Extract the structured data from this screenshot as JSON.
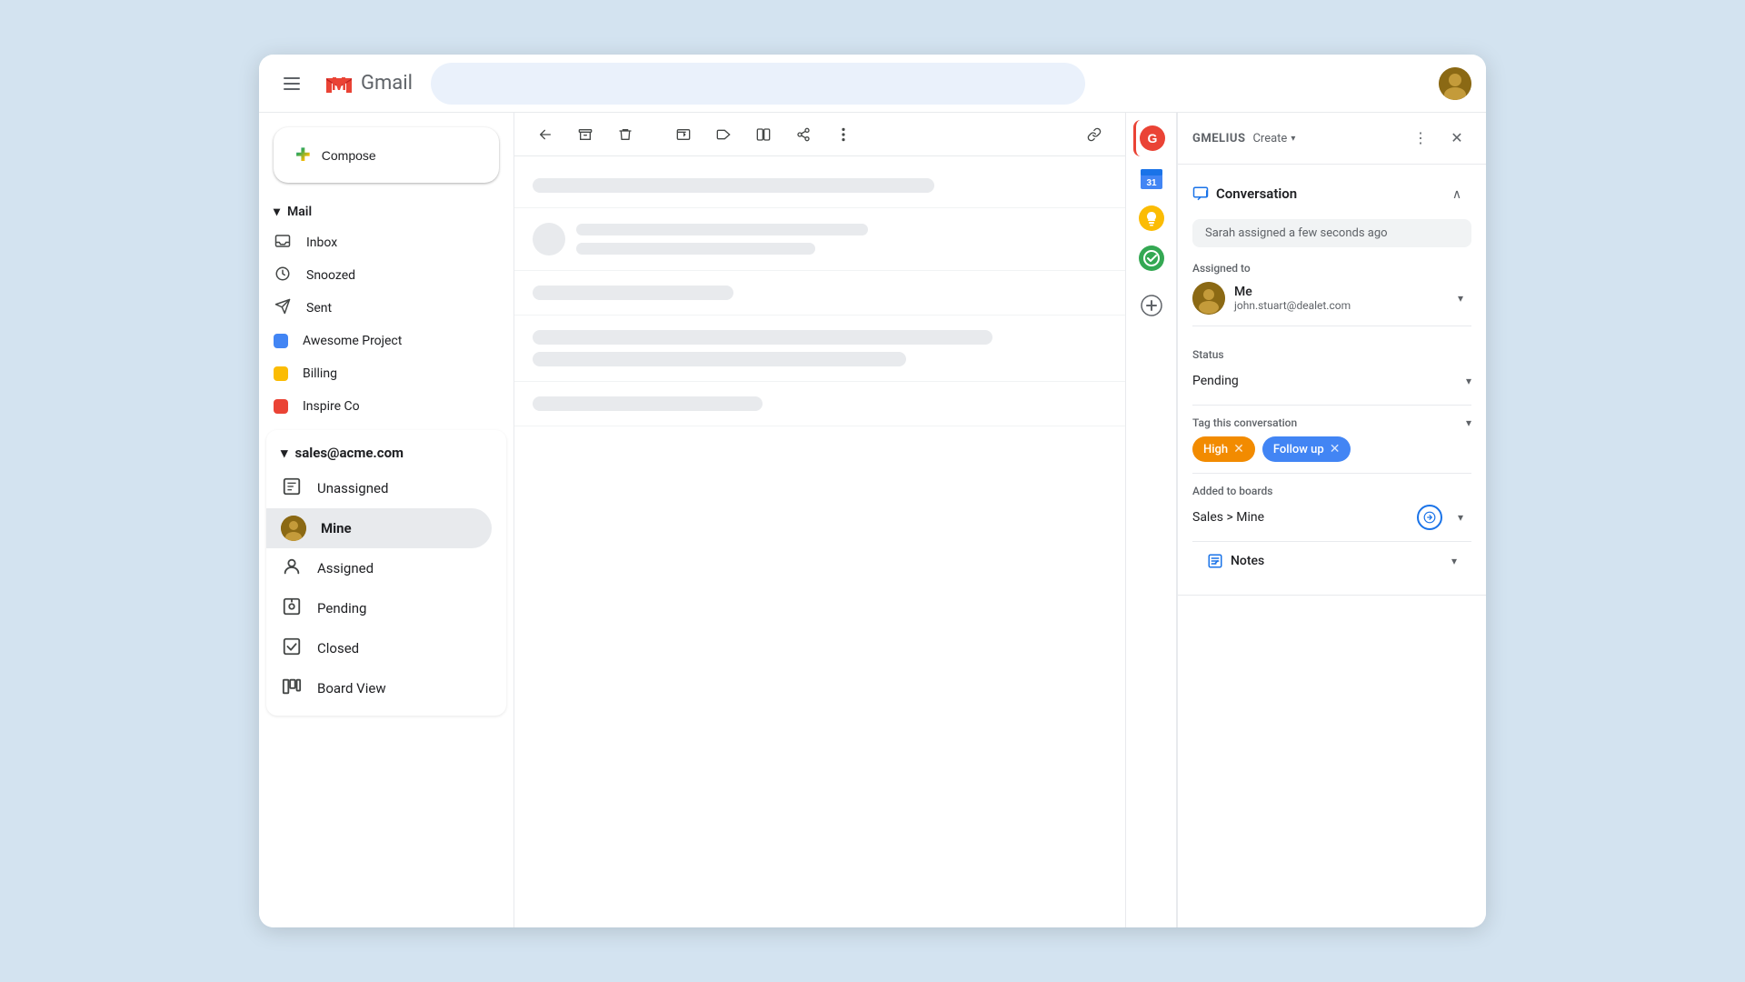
{
  "window": {
    "title": "Gmail"
  },
  "topbar": {
    "menu_label": "☰",
    "logo_text": "Gmail",
    "search_placeholder": "",
    "app_name": "GMELIUS",
    "create_label": "Create",
    "more_label": "⋮",
    "close_label": "✕"
  },
  "sidebar": {
    "mail_section": "Mail",
    "compose_label": "Compose",
    "items": [
      {
        "id": "inbox",
        "label": "Inbox",
        "icon": "☐"
      },
      {
        "id": "snoozed",
        "label": "Snoozed",
        "icon": "⏱"
      },
      {
        "id": "sent",
        "label": "Sent",
        "icon": "▷"
      }
    ],
    "labels": [
      {
        "id": "awesome-project",
        "label": "Awesome Project",
        "color": "#4285f4"
      },
      {
        "id": "billing",
        "label": "Billing",
        "color": "#fbbc04"
      },
      {
        "id": "inspire-co",
        "label": "Inspire Co",
        "color": "#ea4335"
      }
    ]
  },
  "sales": {
    "email": "sales@acme.com",
    "items": [
      {
        "id": "unassigned",
        "label": "Unassigned",
        "icon": "📋"
      },
      {
        "id": "mine",
        "label": "Mine",
        "icon": "avatar",
        "active": true
      },
      {
        "id": "assigned",
        "label": "Assigned",
        "icon": "👤"
      },
      {
        "id": "pending",
        "label": "Pending",
        "icon": "📋"
      },
      {
        "id": "closed",
        "label": "Closed",
        "icon": "☑"
      },
      {
        "id": "board-view",
        "label": "Board View",
        "icon": "⊞"
      }
    ]
  },
  "toolbar": {
    "back_tip": "Back",
    "archive_tip": "Archive",
    "delete_tip": "Delete",
    "move_tip": "Move",
    "label_tip": "Label",
    "split_tip": "Split",
    "more_tip": "More"
  },
  "right_panel": {
    "app_name": "GMELIUS",
    "create_label": "Create",
    "conversation_title": "Conversation",
    "assignment_chip": "Sarah assigned a few seconds ago",
    "assigned_to_label": "Assigned to",
    "assignee_name": "Me",
    "assignee_email": "john.stuart@dealet.com",
    "status_label": "Status",
    "status_value": "Pending",
    "tags_label": "Tag this conversation",
    "tags": [
      {
        "id": "high",
        "label": "High",
        "type": "high"
      },
      {
        "id": "follow-up",
        "label": "Follow up",
        "type": "follow-up"
      }
    ],
    "boards_label": "Added to boards",
    "boards_value": "Sales > Mine",
    "notes_label": "Notes"
  }
}
